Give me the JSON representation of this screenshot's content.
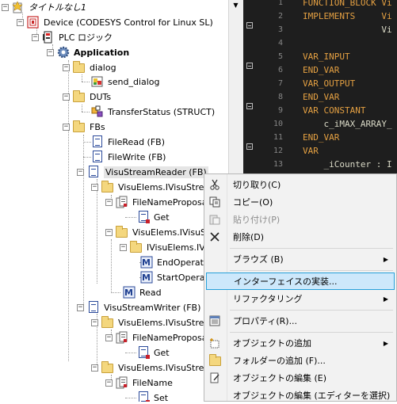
{
  "tree": {
    "nodes": [
      {
        "id": "root",
        "label": "タイトルなし1",
        "italic": true
      },
      {
        "id": "device",
        "label": "Device (CODESYS Control for Linux SL)"
      },
      {
        "id": "plc",
        "label": "PLC ロジック"
      },
      {
        "id": "app",
        "label": "Application",
        "bold": true
      },
      {
        "id": "dialog",
        "label": "dialog"
      },
      {
        "id": "send_dialog",
        "label": "send_dialog"
      },
      {
        "id": "duts",
        "label": "DUTs"
      },
      {
        "id": "transfer",
        "label": "TransferStatus (STRUCT)"
      },
      {
        "id": "fbs",
        "label": "FBs"
      },
      {
        "id": "fileread",
        "label": "FileRead (FB)"
      },
      {
        "id": "filewrite",
        "label": "FileWrite (FB)"
      },
      {
        "id": "vsr",
        "label": "VisuStreamReader (FB)"
      },
      {
        "id": "ve1",
        "label": "VisuElems.IVisuStrea"
      },
      {
        "id": "fnp1",
        "label": "FileNameProposa"
      },
      {
        "id": "get1",
        "label": "Get"
      },
      {
        "id": "ve2",
        "label": "VisuElems.IVisuStrea"
      },
      {
        "id": "ive",
        "label": "IVisuElems.IVisu"
      },
      {
        "id": "endop",
        "label": "EndOperatio"
      },
      {
        "id": "startop",
        "label": "StartOperat"
      },
      {
        "id": "read",
        "label": "Read"
      },
      {
        "id": "vsw",
        "label": "VisuStreamWriter (FB)"
      },
      {
        "id": "ve3",
        "label": "VisuElems.IVisuStrea"
      },
      {
        "id": "fnp2",
        "label": "FileNameProposa"
      },
      {
        "id": "get2",
        "label": "Get"
      },
      {
        "id": "ve4",
        "label": "VisuElems.IVisuStrea"
      },
      {
        "id": "filename",
        "label": "FileName"
      },
      {
        "id": "set",
        "label": "Set"
      }
    ]
  },
  "code": {
    "lines": [
      {
        "n": "1",
        "text": "FUNCTION_BLOCK Vi",
        "cls": "kw"
      },
      {
        "n": "2",
        "text": "IMPLEMENTS     Vi",
        "cls": "kw"
      },
      {
        "n": "3",
        "text": "               Vi",
        "cls": "var"
      },
      {
        "n": "4",
        "text": "",
        "cls": "var"
      },
      {
        "n": "5",
        "text": "VAR_INPUT",
        "cls": "kw"
      },
      {
        "n": "6",
        "text": "END_VAR",
        "cls": "kw"
      },
      {
        "n": "7",
        "text": "VAR_OUTPUT",
        "cls": "kw"
      },
      {
        "n": "8",
        "text": "END_VAR",
        "cls": "kw"
      },
      {
        "n": "9",
        "text": "VAR CONSTANT",
        "cls": "kw"
      },
      {
        "n": "10",
        "text": "    c_iMAX_ARRAY_",
        "cls": "var"
      },
      {
        "n": "11",
        "text": "END_VAR",
        "cls": "kw"
      },
      {
        "n": "12",
        "text": "VAR",
        "cls": "kw"
      },
      {
        "n": "13",
        "text": "    _iCounter : I",
        "cls": "var"
      },
      {
        "n": "14",
        "text": "",
        "cls": "var"
      }
    ]
  },
  "menu": {
    "items": {
      "cut": "切り取り(C)",
      "copy": "コピー(O)",
      "paste": "貼り付け(P)",
      "delete": "削除(D)",
      "browse": "ブラウズ (B)",
      "implement": "インターフェイスの実装...",
      "refactor": "リファクタリング",
      "props": "プロパティ(R)...",
      "addobj": "オブジェクトの追加",
      "addfolder": "フォルダーの追加 (F)...",
      "editobj": "オブジェクトの編集 (E)",
      "editwith": "オブジェクトの編集 (エディターを選択)"
    },
    "submenu_arrow": "▶",
    "colors": {
      "highlight": "#cde8fb",
      "highlight_border": "#26a0da"
    }
  },
  "icons": {
    "expand_minus": "−",
    "dropdown": "▼"
  }
}
